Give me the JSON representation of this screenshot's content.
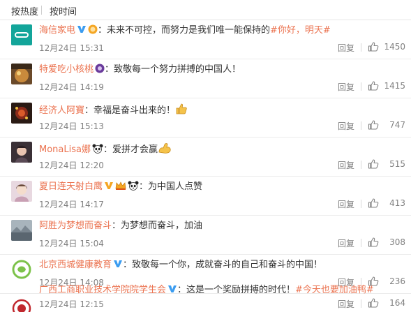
{
  "sort": {
    "by_hot": "按热度",
    "by_time": "按时间"
  },
  "reply_label": "回复",
  "colors": {
    "username": "#eb7350",
    "text": "#333333",
    "meta": "#808080",
    "badge_blue": "#3b9cf0",
    "badge_gold": "#f5a623"
  },
  "comments": [
    {
      "user": "海信家电",
      "badges": [
        "verified-blue-icon",
        "vip-gold-icon"
      ],
      "text": "：未来不可控，而努力是我们唯一能保持的",
      "topic": "#你好，明天#",
      "time": "12月24日 15:31",
      "likes": "1450"
    },
    {
      "user": "特爱吃小核桃",
      "badges": [
        "member-purple-icon"
      ],
      "text": "：致敬每一个努力拼搏的中国人！",
      "topic": "",
      "time": "12月24日 14:19",
      "likes": "1415"
    },
    {
      "user": "经济人阿寶",
      "badges": [],
      "text": "：幸福是奋斗出来的！",
      "topic": "",
      "time": "12月24日 15:13",
      "likes": "747"
    },
    {
      "user": "MonaLisa娜",
      "badges": [
        "panda-icon"
      ],
      "text": "：爱拼才会赢",
      "topic": "",
      "time": "12月24日 12:20",
      "likes": "515"
    },
    {
      "user": "夏日连天射白鹰",
      "badges": [
        "verified-gold-icon",
        "crown-badge-icon",
        "panda-icon"
      ],
      "text": "：为中国人点赞",
      "topic": "",
      "time": "12月24日 14:17",
      "likes": "413"
    },
    {
      "user": "阿胜为梦想而奋斗",
      "badges": [],
      "text": "：为梦想而奋斗，加油",
      "topic": "",
      "time": "12月24日 15:04",
      "likes": "308"
    },
    {
      "user": "北京西城健康教育",
      "badges": [
        "verified-blue-icon"
      ],
      "text": "：致敬每一个你，成就奋斗的自己和奋斗的中国！",
      "topic": "",
      "time": "12月24日 14:08",
      "likes": "236"
    },
    {
      "user": "广西工商职业技术学院院学生会",
      "badges": [
        "verified-blue-icon"
      ],
      "text": "：这是一个奖励拼搏的时代！",
      "topic": "#今天也要加油鸭#",
      "time": "12月24日 12:15",
      "likes": "164"
    }
  ]
}
